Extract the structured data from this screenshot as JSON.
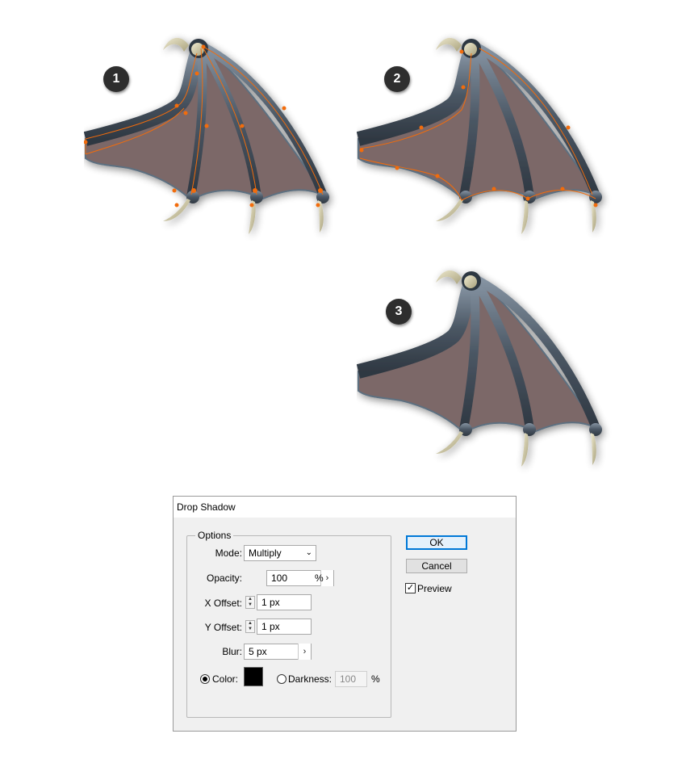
{
  "steps": [
    "1",
    "2",
    "3"
  ],
  "colors": {
    "bone": "#4a5663",
    "membrane": "#7b6868",
    "claw": "#d4cfae",
    "path": "#f26c0c",
    "dialog_bg": "#f0f0f0",
    "accent": "#0078d7"
  },
  "dialog": {
    "title": "Drop Shadow",
    "group_label": "Options",
    "mode": {
      "label": "Mode:",
      "value": "Multiply"
    },
    "opacity": {
      "label": "Opacity:",
      "value": "100",
      "unit": "%"
    },
    "x_offset": {
      "label": "X Offset:",
      "value": "1 px"
    },
    "y_offset": {
      "label": "Y Offset:",
      "value": "1 px"
    },
    "blur": {
      "label": "Blur:",
      "value": "5 px"
    },
    "color": {
      "label": "Color:",
      "swatch": "#000000"
    },
    "darkness": {
      "label": "Darkness:",
      "value": "100",
      "unit": "%"
    },
    "ok_label": "OK",
    "cancel_label": "Cancel",
    "preview_label": "Preview",
    "icons": [
      "chevron-down-icon",
      "chevron-right-icon",
      "spinner-icon",
      "checkmark-icon",
      "radio-icon"
    ]
  }
}
